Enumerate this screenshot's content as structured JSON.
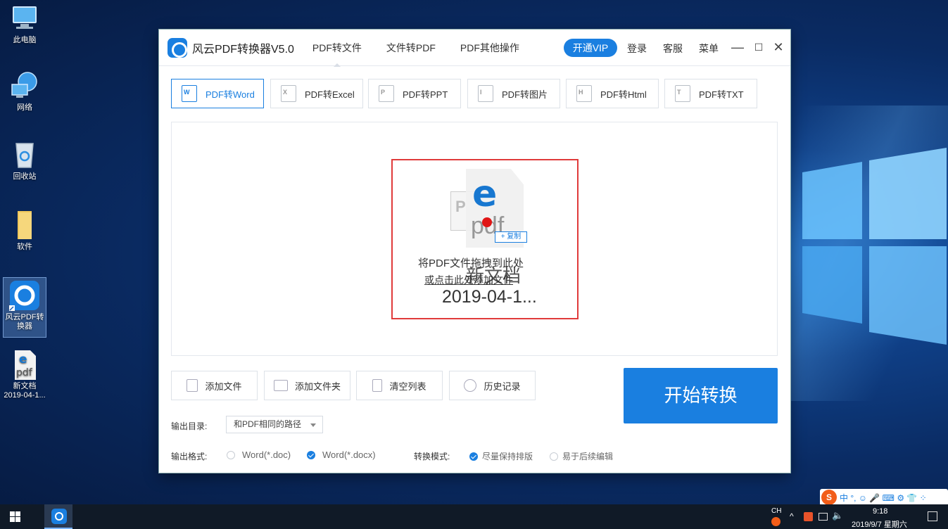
{
  "desktop": {
    "icons": [
      {
        "label": "此电脑"
      },
      {
        "label": "网络"
      },
      {
        "label": "回收站"
      },
      {
        "label": "软件"
      },
      {
        "label": "风云PDF转换器"
      },
      {
        "label": "新文档\n2019-04-1..."
      }
    ]
  },
  "app": {
    "title": "风云PDF转换器V5.0",
    "nav_tabs": [
      "PDF转文件",
      "文件转PDF",
      "PDF其他操作"
    ],
    "vip_label": "开通VIP",
    "login_label": "登录",
    "service_label": "客服",
    "menu_label": "菜单",
    "minimize": "—",
    "maximize": "☐",
    "close": "✕",
    "type_tabs": [
      {
        "label": "PDF转Word",
        "icon": "W"
      },
      {
        "label": "PDF转Excel",
        "icon": "X"
      },
      {
        "label": "PDF转PPT",
        "icon": "P"
      },
      {
        "label": "PDF转图片",
        "icon": "I"
      },
      {
        "label": "PDF转Html",
        "icon": "H"
      },
      {
        "label": "PDF转TXT",
        "icon": "T"
      }
    ],
    "drop": {
      "line1": "将PDF文件拖拽到此处",
      "line2": "或点击此处添加文件",
      "pdf_icon_text": "P",
      "drag_icon_letter": "e",
      "drag_icon_sub": "pdf",
      "copy_tag": "+ 复制",
      "drag_file_name": "新文档",
      "drag_file_date": "2019-04-1..."
    },
    "actions": {
      "add_file": "添加文件",
      "add_folder": "添加文件夹",
      "clear_list": "清空列表",
      "history": "历史记录",
      "start": "开始转换"
    },
    "output": {
      "dir_label": "输出目录:",
      "dir_value": "和PDF相同的路径",
      "format_label": "输出格式:",
      "format_options": [
        "Word(*.doc)",
        "Word(*.docx)"
      ],
      "format_selected": "Word(*.docx)",
      "mode_label": "转换模式:",
      "mode_options": [
        "尽量保持排版",
        "易于后续编辑"
      ],
      "mode_selected": "尽量保持排版"
    }
  },
  "taskbar": {
    "lang": "CH",
    "time": "9:18",
    "date": "2019/9/7 星期六",
    "ime_text": "中 °, ☺ 🎤 ⌨ ⚙ 👕 ⁘"
  }
}
